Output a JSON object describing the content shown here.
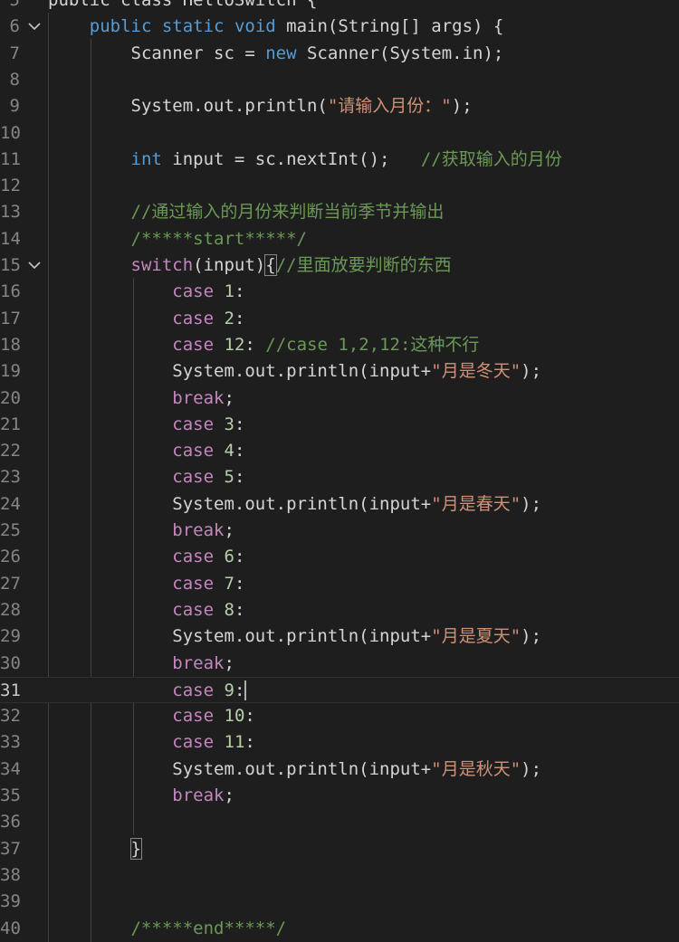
{
  "lines": [
    {
      "num": "5",
      "tokens": [
        {
          "t": "public class HelloSwitch {",
          "c": "plain"
        }
      ]
    },
    {
      "num": "6",
      "fold": true,
      "tokens": [
        {
          "t": "    ",
          "c": "plain"
        },
        {
          "t": "public",
          "c": "kw"
        },
        {
          "t": " ",
          "c": "plain"
        },
        {
          "t": "static",
          "c": "kw"
        },
        {
          "t": " ",
          "c": "plain"
        },
        {
          "t": "void",
          "c": "kw"
        },
        {
          "t": " main(String[] args) {",
          "c": "plain"
        }
      ]
    },
    {
      "num": "7",
      "tokens": [
        {
          "t": "        Scanner sc = ",
          "c": "plain"
        },
        {
          "t": "new",
          "c": "kw"
        },
        {
          "t": " Scanner(System.in);",
          "c": "plain"
        }
      ]
    },
    {
      "num": "8",
      "tokens": []
    },
    {
      "num": "9",
      "tokens": [
        {
          "t": "        System.out.println(",
          "c": "plain"
        },
        {
          "t": "\"请输入月份：\"",
          "c": "str"
        },
        {
          "t": ");",
          "c": "plain"
        }
      ]
    },
    {
      "num": "10",
      "tokens": []
    },
    {
      "num": "11",
      "tokens": [
        {
          "t": "        ",
          "c": "plain"
        },
        {
          "t": "int",
          "c": "kw"
        },
        {
          "t": " input = sc.nextInt();   ",
          "c": "plain"
        },
        {
          "t": "//获取输入的月份",
          "c": "cmt"
        }
      ]
    },
    {
      "num": "12",
      "tokens": []
    },
    {
      "num": "13",
      "tokens": [
        {
          "t": "        ",
          "c": "plain"
        },
        {
          "t": "//通过输入的月份来判断当前季节并输出",
          "c": "cmt"
        }
      ]
    },
    {
      "num": "14",
      "tokens": [
        {
          "t": "        ",
          "c": "plain"
        },
        {
          "t": "/*****start*****/",
          "c": "cmt"
        }
      ]
    },
    {
      "num": "15",
      "fold": true,
      "tokens": [
        {
          "t": "        ",
          "c": "plain"
        },
        {
          "t": "switch",
          "c": "ctl"
        },
        {
          "t": "(input)",
          "c": "plain"
        },
        {
          "t": "{",
          "c": "plain",
          "bracket": true
        },
        {
          "t": "//里面放要判断的东西",
          "c": "cmt"
        }
      ]
    },
    {
      "num": "16",
      "tokens": [
        {
          "t": "            ",
          "c": "plain"
        },
        {
          "t": "case",
          "c": "ctl"
        },
        {
          "t": " ",
          "c": "plain"
        },
        {
          "t": "1",
          "c": "num"
        },
        {
          "t": ":",
          "c": "plain"
        }
      ]
    },
    {
      "num": "17",
      "tokens": [
        {
          "t": "            ",
          "c": "plain"
        },
        {
          "t": "case",
          "c": "ctl"
        },
        {
          "t": " ",
          "c": "plain"
        },
        {
          "t": "2",
          "c": "num"
        },
        {
          "t": ":",
          "c": "plain"
        }
      ]
    },
    {
      "num": "18",
      "tokens": [
        {
          "t": "            ",
          "c": "plain"
        },
        {
          "t": "case",
          "c": "ctl"
        },
        {
          "t": " ",
          "c": "plain"
        },
        {
          "t": "12",
          "c": "num"
        },
        {
          "t": ": ",
          "c": "plain"
        },
        {
          "t": "//case 1,2,12:这种不行",
          "c": "cmt"
        }
      ]
    },
    {
      "num": "19",
      "tokens": [
        {
          "t": "            System.out.println(input+",
          "c": "plain"
        },
        {
          "t": "\"月是冬天\"",
          "c": "str"
        },
        {
          "t": ");",
          "c": "plain"
        }
      ]
    },
    {
      "num": "20",
      "tokens": [
        {
          "t": "            ",
          "c": "plain"
        },
        {
          "t": "break",
          "c": "ctl"
        },
        {
          "t": ";",
          "c": "plain"
        }
      ]
    },
    {
      "num": "21",
      "tokens": [
        {
          "t": "            ",
          "c": "plain"
        },
        {
          "t": "case",
          "c": "ctl"
        },
        {
          "t": " ",
          "c": "plain"
        },
        {
          "t": "3",
          "c": "num"
        },
        {
          "t": ":",
          "c": "plain"
        }
      ]
    },
    {
      "num": "22",
      "tokens": [
        {
          "t": "            ",
          "c": "plain"
        },
        {
          "t": "case",
          "c": "ctl"
        },
        {
          "t": " ",
          "c": "plain"
        },
        {
          "t": "4",
          "c": "num"
        },
        {
          "t": ":",
          "c": "plain"
        }
      ]
    },
    {
      "num": "23",
      "tokens": [
        {
          "t": "            ",
          "c": "plain"
        },
        {
          "t": "case",
          "c": "ctl"
        },
        {
          "t": " ",
          "c": "plain"
        },
        {
          "t": "5",
          "c": "num"
        },
        {
          "t": ":",
          "c": "plain"
        }
      ]
    },
    {
      "num": "24",
      "tokens": [
        {
          "t": "            System.out.println(input+",
          "c": "plain"
        },
        {
          "t": "\"月是春天\"",
          "c": "str"
        },
        {
          "t": ");",
          "c": "plain"
        }
      ]
    },
    {
      "num": "25",
      "tokens": [
        {
          "t": "            ",
          "c": "plain"
        },
        {
          "t": "break",
          "c": "ctl"
        },
        {
          "t": ";",
          "c": "plain"
        }
      ]
    },
    {
      "num": "26",
      "tokens": [
        {
          "t": "            ",
          "c": "plain"
        },
        {
          "t": "case",
          "c": "ctl"
        },
        {
          "t": " ",
          "c": "plain"
        },
        {
          "t": "6",
          "c": "num"
        },
        {
          "t": ":",
          "c": "plain"
        }
      ]
    },
    {
      "num": "27",
      "tokens": [
        {
          "t": "            ",
          "c": "plain"
        },
        {
          "t": "case",
          "c": "ctl"
        },
        {
          "t": " ",
          "c": "plain"
        },
        {
          "t": "7",
          "c": "num"
        },
        {
          "t": ":",
          "c": "plain"
        }
      ]
    },
    {
      "num": "28",
      "tokens": [
        {
          "t": "            ",
          "c": "plain"
        },
        {
          "t": "case",
          "c": "ctl"
        },
        {
          "t": " ",
          "c": "plain"
        },
        {
          "t": "8",
          "c": "num"
        },
        {
          "t": ":",
          "c": "plain"
        }
      ]
    },
    {
      "num": "29",
      "tokens": [
        {
          "t": "            System.out.println(input+",
          "c": "plain"
        },
        {
          "t": "\"月是夏天\"",
          "c": "str"
        },
        {
          "t": ");",
          "c": "plain"
        }
      ]
    },
    {
      "num": "30",
      "tokens": [
        {
          "t": "            ",
          "c": "plain"
        },
        {
          "t": "break",
          "c": "ctl"
        },
        {
          "t": ";",
          "c": "plain"
        }
      ]
    },
    {
      "num": "31",
      "current": true,
      "tokens": [
        {
          "t": "            ",
          "c": "plain"
        },
        {
          "t": "case",
          "c": "ctl"
        },
        {
          "t": " ",
          "c": "plain"
        },
        {
          "t": "9",
          "c": "num"
        },
        {
          "t": ":",
          "c": "plain"
        },
        {
          "cursor": true
        }
      ]
    },
    {
      "num": "32",
      "tokens": [
        {
          "t": "            ",
          "c": "plain"
        },
        {
          "t": "case",
          "c": "ctl"
        },
        {
          "t": " ",
          "c": "plain"
        },
        {
          "t": "10",
          "c": "num"
        },
        {
          "t": ":",
          "c": "plain"
        }
      ]
    },
    {
      "num": "33",
      "tokens": [
        {
          "t": "            ",
          "c": "plain"
        },
        {
          "t": "case",
          "c": "ctl"
        },
        {
          "t": " ",
          "c": "plain"
        },
        {
          "t": "11",
          "c": "num"
        },
        {
          "t": ":",
          "c": "plain"
        }
      ]
    },
    {
      "num": "34",
      "tokens": [
        {
          "t": "            System.out.println(input+",
          "c": "plain"
        },
        {
          "t": "\"月是秋天\"",
          "c": "str"
        },
        {
          "t": ");",
          "c": "plain"
        }
      ]
    },
    {
      "num": "35",
      "tokens": [
        {
          "t": "            ",
          "c": "plain"
        },
        {
          "t": "break",
          "c": "ctl"
        },
        {
          "t": ";",
          "c": "plain"
        }
      ]
    },
    {
      "num": "36",
      "tokens": []
    },
    {
      "num": "37",
      "tokens": [
        {
          "t": "        ",
          "c": "plain"
        },
        {
          "t": "}",
          "c": "plain",
          "bracket": true
        }
      ]
    },
    {
      "num": "38",
      "tokens": []
    },
    {
      "num": "39",
      "tokens": []
    },
    {
      "num": "40",
      "tokens": [
        {
          "t": "        ",
          "c": "plain"
        },
        {
          "t": "/*****end*****/",
          "c": "cmt"
        }
      ]
    }
  ]
}
